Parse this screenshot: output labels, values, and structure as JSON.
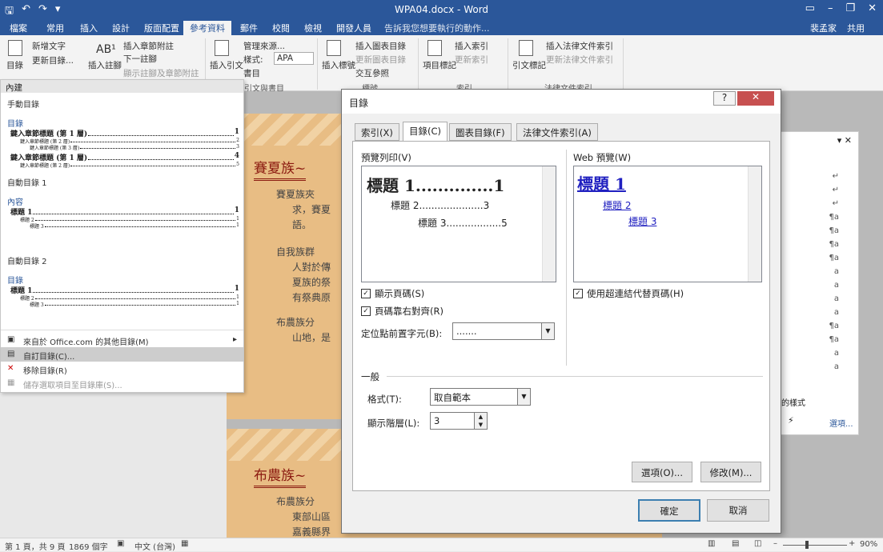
{
  "window": {
    "title": "WPA04.docx - Word"
  },
  "tabs": [
    "檔案",
    "常用",
    "插入",
    "設計",
    "版面配置",
    "參考資料",
    "郵件",
    "校閱",
    "檢視",
    "開發人員"
  ],
  "tell_me": "告訴我您想要執行的動作...",
  "user": "裴孟家",
  "share": "共用",
  "ribbon": {
    "toc_btn": "目錄",
    "add_text": "新增文字",
    "update_table": "更新目錄...",
    "insert_footnote": "插入註腳",
    "insert_endnote": "插入章節附註",
    "next_footnote": "下一註腳",
    "show_notes": "顯示註腳及章節附註",
    "insert_citation": "插入引文",
    "manage_sources": "管理來源...",
    "style_label": "樣式:",
    "style_value": "APA",
    "bibliography": "書目",
    "insert_caption": "插入標號",
    "insert_tof": "插入圖表目錄",
    "update_table2": "更新圖表目錄",
    "cross_ref": "交互參照",
    "mark_entry": "項目標記",
    "insert_index": "插入索引",
    "update_index": "更新索引",
    "mark_citation": "引文標記",
    "insert_toa": "插入法律文件索引",
    "update_toa": "更新法律文件索引",
    "groups": {
      "citations": "引文與書目",
      "captions": "標號",
      "index": "索引",
      "toa": "法律文件索引"
    }
  },
  "dropdown": {
    "builtin": "內建",
    "manual": "手動目錄",
    "manual_preview": {
      "title": "目錄",
      "ch1": "鍵入章節標題 (第 1 層)",
      "sub2": "鍵入章節標題 (第 2 層)",
      "sub3": "鍵入章節標題 (第 3 層)",
      "p1": "1",
      "p2": "2",
      "p3": "3",
      "p4": "4",
      "p5": "5"
    },
    "auto1": "自動目錄 1",
    "auto1_title": "內容",
    "auto2": "自動目錄 2",
    "auto2_title": "目錄",
    "h1": "標題 1",
    "h2": "標題 2",
    "h3": "標題 3",
    "pg": "1",
    "menu": [
      "來自於 Office.com 的其他目錄(M)",
      "自訂目錄(C)...",
      "移除目錄(R)",
      "儲存選取項目至目錄庫(S)..."
    ]
  },
  "document": {
    "heading1": "賽夏族~",
    "heading2": "布農族~",
    "bullets1": [
      "賽夏族夾",
      "求，賽夏",
      "語。"
    ],
    "bullets2": [
      "自我族群",
      "人對於傳",
      "夏族的祭",
      "有祭典原"
    ],
    "bullets3": [
      "布農族分",
      "山地，是"
    ],
    "bullets4": [
      "布農族分",
      "東部山區",
      "嘉義縣界"
    ]
  },
  "dialog": {
    "title": "目錄",
    "help": "?",
    "close": "✕",
    "tabs": [
      "索引(X)",
      "目錄(C)",
      "圖表目錄(F)",
      "法律文件索引(A)"
    ],
    "print_preview_label": "預覽列印(V)",
    "web_preview_label": "Web 預覽(W)",
    "print": {
      "h1": "標題",
      "h1n": "1",
      "h1p": "1",
      "h2": "標題 2",
      "h2p": "3",
      "h3": "標題 3",
      "h3p": "5"
    },
    "web": {
      "h1": "標題 1",
      "h2": "標題 2",
      "h3": "標題 3"
    },
    "show_page_numbers": "顯示頁碼(S)",
    "right_align": "頁碼靠右對齊(R)",
    "tab_leader_label": "定位點前置字元(B):",
    "tab_leader_value": ".......",
    "use_hyperlinks": "使用超連結代替頁碼(H)",
    "general": "一般",
    "formats_label": "格式(T):",
    "formats_value": "取自範本",
    "levels_label": "顯示階層(L):",
    "levels_value": "3",
    "options": "選項(O)...",
    "modify": "修改(M)...",
    "ok": "確定",
    "cancel": "取消"
  },
  "sidepane": {
    "style_note": "的樣式",
    "options_link": "選項...",
    "marks": [
      "↵",
      "↵",
      "↵",
      "¶a",
      "¶a",
      "¶a",
      "¶a",
      "a",
      "a",
      "a",
      "a",
      "¶a",
      "¶a",
      "a",
      "a"
    ]
  },
  "status": {
    "page": "第 1 頁，共 9 頁",
    "words": "1869 個字",
    "lang": "中文 (台灣)",
    "zoom": "90%"
  }
}
